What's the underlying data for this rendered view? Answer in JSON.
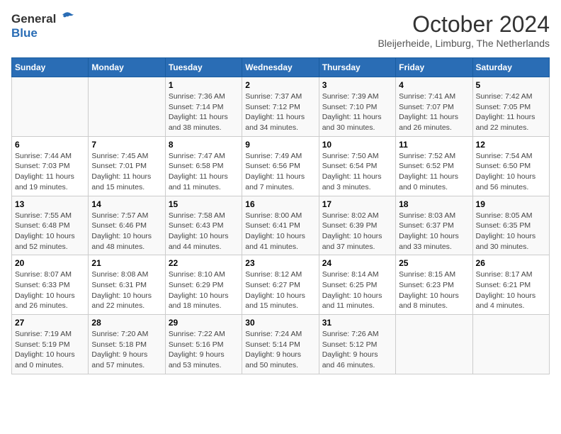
{
  "header": {
    "logo_general": "General",
    "logo_blue": "Blue",
    "month": "October 2024",
    "location": "Bleijerheide, Limburg, The Netherlands"
  },
  "days_of_week": [
    "Sunday",
    "Monday",
    "Tuesday",
    "Wednesday",
    "Thursday",
    "Friday",
    "Saturday"
  ],
  "weeks": [
    [
      {
        "day": "",
        "info": ""
      },
      {
        "day": "",
        "info": ""
      },
      {
        "day": "1",
        "info": "Sunrise: 7:36 AM\nSunset: 7:14 PM\nDaylight: 11 hours\nand 38 minutes."
      },
      {
        "day": "2",
        "info": "Sunrise: 7:37 AM\nSunset: 7:12 PM\nDaylight: 11 hours\nand 34 minutes."
      },
      {
        "day": "3",
        "info": "Sunrise: 7:39 AM\nSunset: 7:10 PM\nDaylight: 11 hours\nand 30 minutes."
      },
      {
        "day": "4",
        "info": "Sunrise: 7:41 AM\nSunset: 7:07 PM\nDaylight: 11 hours\nand 26 minutes."
      },
      {
        "day": "5",
        "info": "Sunrise: 7:42 AM\nSunset: 7:05 PM\nDaylight: 11 hours\nand 22 minutes."
      }
    ],
    [
      {
        "day": "6",
        "info": "Sunrise: 7:44 AM\nSunset: 7:03 PM\nDaylight: 11 hours\nand 19 minutes."
      },
      {
        "day": "7",
        "info": "Sunrise: 7:45 AM\nSunset: 7:01 PM\nDaylight: 11 hours\nand 15 minutes."
      },
      {
        "day": "8",
        "info": "Sunrise: 7:47 AM\nSunset: 6:58 PM\nDaylight: 11 hours\nand 11 minutes."
      },
      {
        "day": "9",
        "info": "Sunrise: 7:49 AM\nSunset: 6:56 PM\nDaylight: 11 hours\nand 7 minutes."
      },
      {
        "day": "10",
        "info": "Sunrise: 7:50 AM\nSunset: 6:54 PM\nDaylight: 11 hours\nand 3 minutes."
      },
      {
        "day": "11",
        "info": "Sunrise: 7:52 AM\nSunset: 6:52 PM\nDaylight: 11 hours\nand 0 minutes."
      },
      {
        "day": "12",
        "info": "Sunrise: 7:54 AM\nSunset: 6:50 PM\nDaylight: 10 hours\nand 56 minutes."
      }
    ],
    [
      {
        "day": "13",
        "info": "Sunrise: 7:55 AM\nSunset: 6:48 PM\nDaylight: 10 hours\nand 52 minutes."
      },
      {
        "day": "14",
        "info": "Sunrise: 7:57 AM\nSunset: 6:46 PM\nDaylight: 10 hours\nand 48 minutes."
      },
      {
        "day": "15",
        "info": "Sunrise: 7:58 AM\nSunset: 6:43 PM\nDaylight: 10 hours\nand 44 minutes."
      },
      {
        "day": "16",
        "info": "Sunrise: 8:00 AM\nSunset: 6:41 PM\nDaylight: 10 hours\nand 41 minutes."
      },
      {
        "day": "17",
        "info": "Sunrise: 8:02 AM\nSunset: 6:39 PM\nDaylight: 10 hours\nand 37 minutes."
      },
      {
        "day": "18",
        "info": "Sunrise: 8:03 AM\nSunset: 6:37 PM\nDaylight: 10 hours\nand 33 minutes."
      },
      {
        "day": "19",
        "info": "Sunrise: 8:05 AM\nSunset: 6:35 PM\nDaylight: 10 hours\nand 30 minutes."
      }
    ],
    [
      {
        "day": "20",
        "info": "Sunrise: 8:07 AM\nSunset: 6:33 PM\nDaylight: 10 hours\nand 26 minutes."
      },
      {
        "day": "21",
        "info": "Sunrise: 8:08 AM\nSunset: 6:31 PM\nDaylight: 10 hours\nand 22 minutes."
      },
      {
        "day": "22",
        "info": "Sunrise: 8:10 AM\nSunset: 6:29 PM\nDaylight: 10 hours\nand 18 minutes."
      },
      {
        "day": "23",
        "info": "Sunrise: 8:12 AM\nSunset: 6:27 PM\nDaylight: 10 hours\nand 15 minutes."
      },
      {
        "day": "24",
        "info": "Sunrise: 8:14 AM\nSunset: 6:25 PM\nDaylight: 10 hours\nand 11 minutes."
      },
      {
        "day": "25",
        "info": "Sunrise: 8:15 AM\nSunset: 6:23 PM\nDaylight: 10 hours\nand 8 minutes."
      },
      {
        "day": "26",
        "info": "Sunrise: 8:17 AM\nSunset: 6:21 PM\nDaylight: 10 hours\nand 4 minutes."
      }
    ],
    [
      {
        "day": "27",
        "info": "Sunrise: 7:19 AM\nSunset: 5:19 PM\nDaylight: 10 hours\nand 0 minutes."
      },
      {
        "day": "28",
        "info": "Sunrise: 7:20 AM\nSunset: 5:18 PM\nDaylight: 9 hours\nand 57 minutes."
      },
      {
        "day": "29",
        "info": "Sunrise: 7:22 AM\nSunset: 5:16 PM\nDaylight: 9 hours\nand 53 minutes."
      },
      {
        "day": "30",
        "info": "Sunrise: 7:24 AM\nSunset: 5:14 PM\nDaylight: 9 hours\nand 50 minutes."
      },
      {
        "day": "31",
        "info": "Sunrise: 7:26 AM\nSunset: 5:12 PM\nDaylight: 9 hours\nand 46 minutes."
      },
      {
        "day": "",
        "info": ""
      },
      {
        "day": "",
        "info": ""
      }
    ]
  ]
}
